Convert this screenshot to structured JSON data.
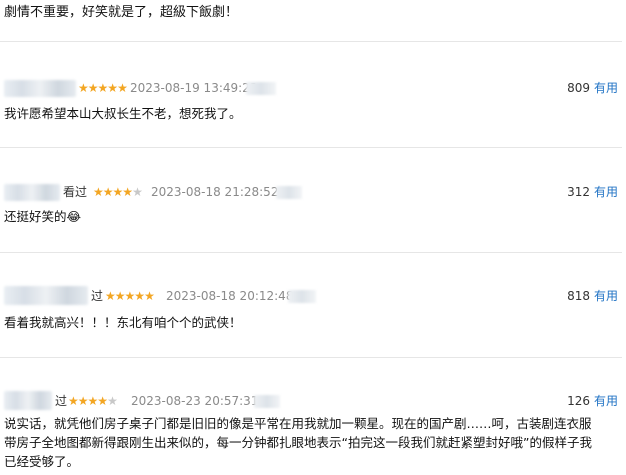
{
  "top_comment": "劇情不重要，好笑就是了，超級下飯劇！",
  "comments": [
    {
      "watched": "",
      "rating": 5,
      "time": "2023-08-19 13:49:23",
      "count": "809",
      "useful_label": "有用",
      "text": "我许愿希望本山大叔长生不老，想死我了。"
    },
    {
      "watched": "看过",
      "rating": 4,
      "time": "2023-08-18 21:28:52",
      "count": "312",
      "useful_label": "有用",
      "text": "还挺好笑的😂"
    },
    {
      "watched": "过",
      "rating": 5,
      "time": "2023-08-18 20:12:48",
      "count": "818",
      "useful_label": "有用",
      "text": "看着我就高兴！！！东北有咱个个的武侠！"
    },
    {
      "watched": "过",
      "rating": 4,
      "time": "2023-08-23 20:57:31",
      "count": "126",
      "useful_label": "有用",
      "text_lines": [
        "说实话，就凭他们房子桌子门都是旧旧的像是平常在用我就加一颗星。现在的国产剧……呵，古装剧连衣服",
        "带房子全地图都新得跟刚生出来似的，每一分钟都扎眼地表示“拍完这一段我们就赶紧塑封好哦”的假样子我",
        "已经受够了。"
      ]
    }
  ],
  "colors": {
    "star": "#f3a623",
    "useful": "#1f72c4",
    "time": "#8a8a8a"
  },
  "icons": [
    "star-icon"
  ]
}
